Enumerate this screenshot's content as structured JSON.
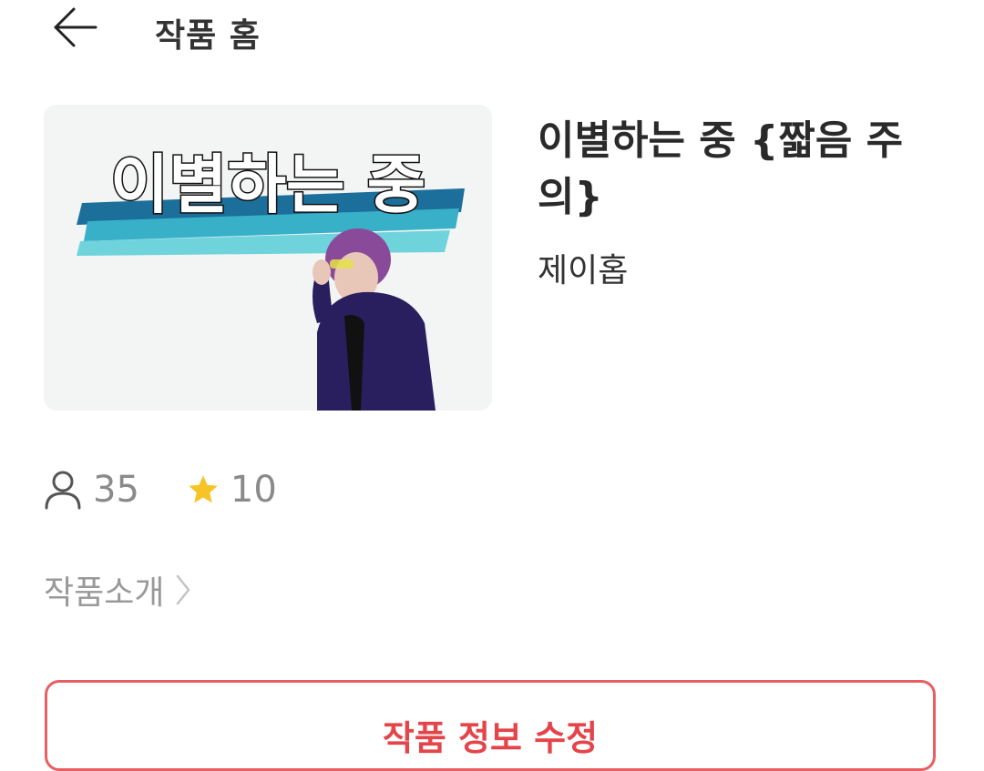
{
  "header": {
    "back_icon": "arrow-left-icon",
    "title": "작품 홈"
  },
  "work": {
    "cover_text": "이별하는 중",
    "title": "이별하는 중 {짧음 주의}",
    "author": "제이홉"
  },
  "stats": {
    "readers_icon": "person-icon",
    "readers": "35",
    "stars_icon": "star-icon",
    "stars": "10",
    "star_color": "#f7c325"
  },
  "intro": {
    "label": "작품소개",
    "chevron_icon": "chevron-right-icon"
  },
  "actions": {
    "edit_label": "작품 정보 수정",
    "accent_color": "#e4454a"
  }
}
